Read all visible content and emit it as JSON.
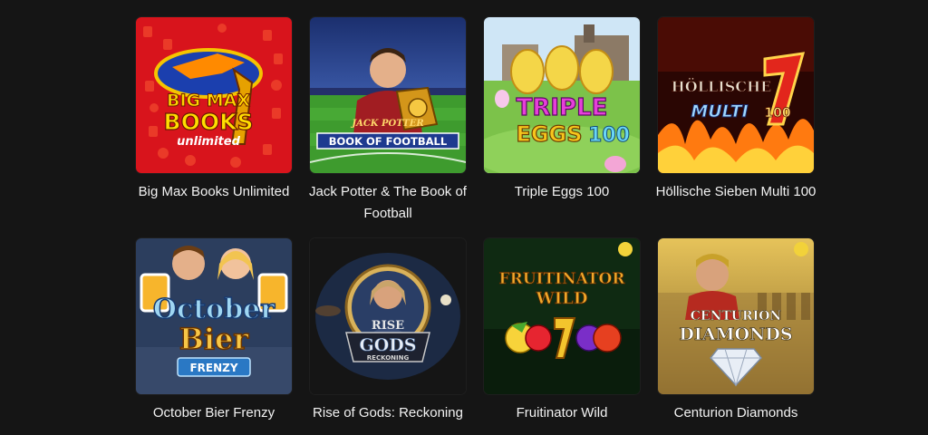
{
  "games": [
    {
      "title": "Big Max Books Unlimited",
      "logo": [
        "BIG MAX",
        "BOOKS",
        "unlimited"
      ]
    },
    {
      "title": "Jack Potter & The Book of Football",
      "logo": [
        "JACK POTTER",
        "BOOK OF FOOTBALL"
      ]
    },
    {
      "title": "Triple Eggs 100",
      "logo": [
        "TRIPLE",
        "EGGS",
        "100"
      ]
    },
    {
      "title": "Höllische Sieben Multi 100",
      "logo": [
        "HÖLLISCHE",
        "MULTI",
        "100"
      ]
    },
    {
      "title": "October Bier Frenzy",
      "logo": [
        "October",
        "Bier",
        "FRENZY"
      ]
    },
    {
      "title": "Rise of Gods: Reckoning",
      "logo": [
        "RISE",
        "GODS",
        "RECKONING"
      ]
    },
    {
      "title": "Fruitinator Wild",
      "logo": [
        "FRUITINATOR",
        "WILD"
      ]
    },
    {
      "title": "Centurion Diamonds",
      "logo": [
        "CENTURION",
        "DIAMONDS"
      ]
    }
  ],
  "colors": {
    "background": "#151515",
    "text": "#f2f2f2"
  }
}
